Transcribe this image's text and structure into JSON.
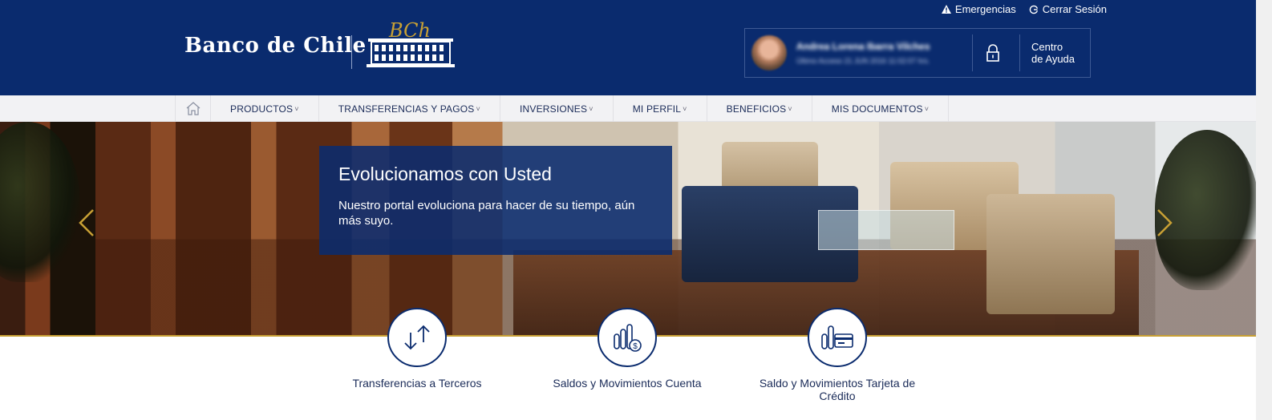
{
  "header": {
    "top_links": [
      {
        "label": "Emergencias",
        "icon": "warning-icon"
      },
      {
        "label": "Cerrar Sesión",
        "icon": "power-icon"
      }
    ],
    "logo_text": "Banco de Chile",
    "user": {
      "name": "Andrea Lorena Ibarra Vilches",
      "last_access": "Último Acceso 21 JUN 2016 11:02:07 hrs."
    },
    "help_label_line1": "Centro",
    "help_label_line2": "de Ayuda"
  },
  "nav": {
    "items": [
      {
        "label": "PRODUCTOS"
      },
      {
        "label": "TRANSFERENCIAS Y PAGOS"
      },
      {
        "label": "INVERSIONES"
      },
      {
        "label": "MI PERFIL"
      },
      {
        "label": "BENEFICIOS"
      },
      {
        "label": "MIS DOCUMENTOS"
      }
    ],
    "caret": "˅"
  },
  "hero": {
    "title": "Evolucionamos con Usted",
    "text": "Nuestro portal evoluciona para hacer de su tiempo, aún más suyo."
  },
  "shortcuts": [
    {
      "label": "Transferencias a Terceros",
      "icon": "transfer-arrows-icon"
    },
    {
      "label": "Saldos y Movimientos Cuenta",
      "icon": "balance-coins-icon"
    },
    {
      "label": "Saldo y Movimientos Tarjeta de Crédito",
      "icon": "credit-card-icon"
    }
  ],
  "colors": {
    "brand_navy": "#0a2b6e",
    "accent_gold": "#c8a034"
  }
}
